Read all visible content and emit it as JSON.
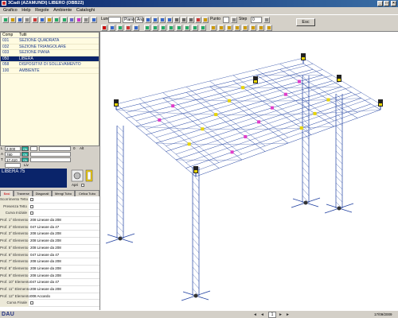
{
  "window": {
    "title": "3Cadi (AZAMUNDI) LIBERO (OBB22)",
    "controls": {
      "minimize": "_",
      "maximize": "□",
      "close": "×"
    }
  },
  "menu": [
    "Grafico",
    "Help",
    "Regole",
    "Ambiente",
    "Cataloghi"
  ],
  "toolbar": {
    "lung_label": "Lung",
    "piano_label": "Piano",
    "ang_label": "Ang",
    "punto_label": "Punto",
    "step_label": "Step",
    "step_value": "0",
    "esc_label": "Esc"
  },
  "components": {
    "headers": {
      "comp": "Comp",
      "title": "Tutti"
    },
    "rows": [
      {
        "code": "031",
        "name": "SEZIONE QUADRATA",
        "selected": false
      },
      {
        "code": "032",
        "name": "SEZIONE TRIANGOLARE",
        "selected": false
      },
      {
        "code": "033",
        "name": "SEZIONE PIANA",
        "selected": false
      },
      {
        "code": "050",
        "name": "LIBERA",
        "selected": true
      },
      {
        "code": "058",
        "name": "DISPOSITIVI DI SOLLEVAMENTO",
        "selected": false
      },
      {
        "code": "100",
        "name": "AMBIENTE",
        "selected": false
      }
    ]
  },
  "controls": {
    "l_label": "L",
    "l_value": "2.000",
    "ok_label": "Ok",
    "alt_label": "Alt",
    "a_label": "A",
    "a_value": "780",
    "a_btn": "Ok",
    "t_label": "T",
    "t_value": "17.410",
    "t_btn": "Ok",
    "zero": "0",
    "liv_label": "Liv"
  },
  "selection": {
    "name": "LIBERA 75",
    "apri_label": "Apri"
  },
  "tabs": [
    "Basi",
    "Traverse",
    "Diagonali",
    "Mengi Tubo",
    "Celica Tubo"
  ],
  "properties": [
    {
      "label": "Scorrimento Tetto",
      "value": "",
      "checkbox": true
    },
    {
      "label": "Presenza Tetto",
      "value": "",
      "checkbox": true
    },
    {
      "label": "Curva Iniziale",
      "value": "",
      "checkbox": true
    },
    {
      "label": "Prof. 1° Elemento",
      "value": "208 Lineare da 208",
      "checkbox": false
    },
    {
      "label": "Prof. 2° Elemento",
      "value": "047 Lineare da 47",
      "checkbox": false
    },
    {
      "label": "Prof. 3° Elemento",
      "value": "208 Lineare da 208",
      "checkbox": false
    },
    {
      "label": "Prof. 4° Elemento",
      "value": "208 Lineare da 208",
      "checkbox": false
    },
    {
      "label": "Prof. 5° Elemento",
      "value": "208 Lineare da 208",
      "checkbox": false
    },
    {
      "label": "Prof. 6° Elemento",
      "value": "047 Lineare da 47",
      "checkbox": false
    },
    {
      "label": "Prof. 7° Elemento",
      "value": "208 Lineare da 208",
      "checkbox": false
    },
    {
      "label": "Prof. 8° Elemento",
      "value": "208 Lineare da 208",
      "checkbox": false
    },
    {
      "label": "Prof. 9° Elemento",
      "value": "208 Lineare da 208",
      "checkbox": false
    },
    {
      "label": "Prof. 10° Elemento",
      "value": "047 Lineare da 47",
      "checkbox": false
    },
    {
      "label": "Prof. 11° Elemento",
      "value": "208 Lineare da 208",
      "checkbox": false
    },
    {
      "label": "Prof. 12° Elemento",
      "value": "008 Accardo",
      "checkbox": false
    },
    {
      "label": "Curva Finale",
      "value": "",
      "checkbox": true
    }
  ],
  "status": {
    "logo": "DAU",
    "page": "1",
    "date": "17/09/2009"
  },
  "colors": {
    "titlebar": "#0a246a",
    "selection": "#0a246a",
    "truss": "#1e3fa0",
    "component_text": "#1a3a8a"
  }
}
